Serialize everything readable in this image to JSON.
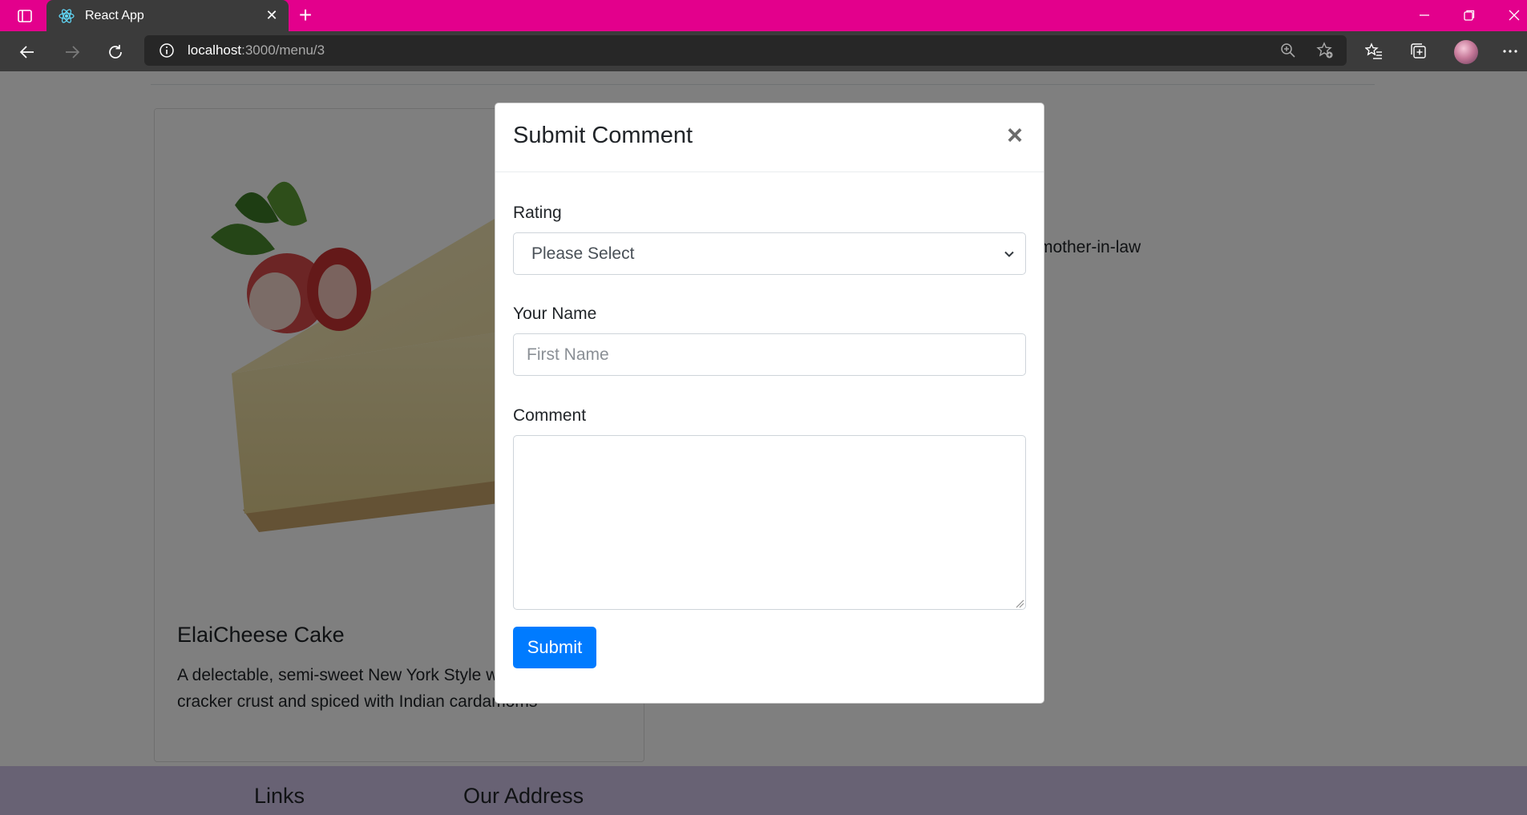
{
  "browser": {
    "tab_title": "React App",
    "url_host": "localhost",
    "url_path": ":3000/menu/3"
  },
  "dish": {
    "name": "ElaiCheese Cake",
    "description": "A delectable, semi-sweet New York Style with Graham cracker crust and spiced with Indian cardamoms"
  },
  "background_comment_fragment": "mother-in-law",
  "footer": {
    "links_heading": "Links",
    "address_heading": "Our Address"
  },
  "modal": {
    "title": "Submit Comment",
    "close_glyph": "×",
    "rating_label": "Rating",
    "rating_selected": "Please Select",
    "name_label": "Your Name",
    "name_placeholder": "First Name",
    "comment_label": "Comment",
    "submit_label": "Submit"
  },
  "colors": {
    "titlebar": "#e3008c",
    "toolbar": "#3b3b3b",
    "primary_button": "#007bff",
    "footer": "#d1c4e9"
  }
}
